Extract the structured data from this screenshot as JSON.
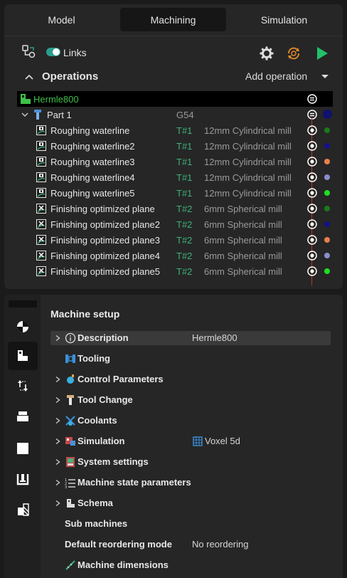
{
  "tabs": [
    "Model",
    "Machining",
    "Simulation"
  ],
  "toolbar": {
    "links_label": "Links",
    "links_on": true
  },
  "operations": {
    "title": "Operations",
    "add_label": "Add operation"
  },
  "tree": {
    "machine": "Hermle800",
    "part": {
      "name": "Part 1",
      "offset": "G54"
    },
    "ops": [
      {
        "name": "Roughing waterline",
        "tool": "T#1",
        "desc": "12mm Cylindrical mill",
        "color": "#1a7a1a"
      },
      {
        "name": "Roughing waterline2",
        "tool": "T#1",
        "desc": "12mm Cylindrical mill",
        "color": "#12128c"
      },
      {
        "name": "Roughing waterline3",
        "tool": "T#1",
        "desc": "12mm Cylindrical mill",
        "color": "#e8804a"
      },
      {
        "name": "Roughing waterline4",
        "tool": "T#1",
        "desc": "12mm Cylindrical mill",
        "color": "#8c8ccc"
      },
      {
        "name": "Roughing waterline5",
        "tool": "T#1",
        "desc": "12mm Cylindrical mill",
        "color": "#1ee01e"
      },
      {
        "name": "Finishing optimized plane",
        "tool": "T#2",
        "desc": "6mm Spherical mill",
        "color": "#1a7a1a"
      },
      {
        "name": "Finishing optimized plane2",
        "tool": "T#2",
        "desc": "6mm Spherical mill",
        "color": "#12128c"
      },
      {
        "name": "Finishing optimized plane3",
        "tool": "T#2",
        "desc": "6mm Spherical mill",
        "color": "#e8804a"
      },
      {
        "name": "Finishing optimized plane4",
        "tool": "T#2",
        "desc": "6mm Spherical mill",
        "color": "#8c8ccc"
      },
      {
        "name": "Finishing optimized plane5",
        "tool": "T#2",
        "desc": "6mm Spherical mill",
        "color": "#1ee01e"
      }
    ],
    "part_color": "#10106e"
  },
  "setup": {
    "title": "Machine setup",
    "props": [
      {
        "label": "Description",
        "value": "Hermle800"
      },
      {
        "label": "Tooling",
        "value": ""
      },
      {
        "label": "Control Parameters",
        "value": ""
      },
      {
        "label": "Tool Change",
        "value": ""
      },
      {
        "label": "Coolants",
        "value": ""
      },
      {
        "label": "Simulation",
        "value": "Voxel 5d"
      },
      {
        "label": "System settings",
        "value": ""
      },
      {
        "label": "Machine state parameters",
        "value": ""
      },
      {
        "label": "Schema",
        "value": ""
      },
      {
        "label": "Sub machines",
        "value": ""
      },
      {
        "label": "Default reordering mode",
        "value": "No reordering"
      },
      {
        "label": "Machine dimensions",
        "value": ""
      }
    ]
  },
  "colors": {
    "accent": "#2a9d8f",
    "tool_green": "#3fb07a",
    "machine_green": "#3fc04a",
    "run_green": "#22c06a"
  }
}
